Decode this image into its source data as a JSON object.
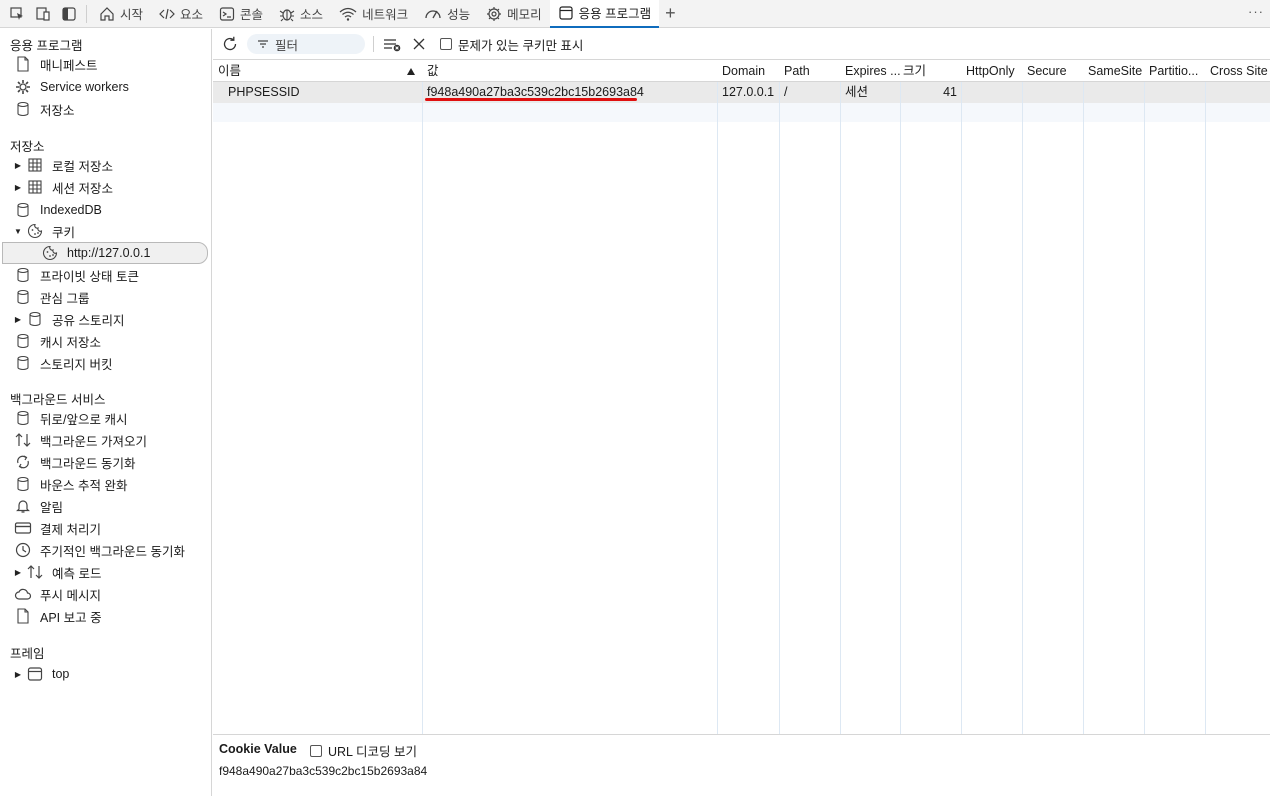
{
  "topbar": {
    "tabs": [
      {
        "label": "시작",
        "icon": "home-icon"
      },
      {
        "label": "요소",
        "icon": "code-icon"
      },
      {
        "label": "콘솔",
        "icon": "console-icon"
      },
      {
        "label": "소스",
        "icon": "bug-icon"
      },
      {
        "label": "네트워크",
        "icon": "wifi-icon"
      },
      {
        "label": "성능",
        "icon": "gauge-icon"
      },
      {
        "label": "메모리",
        "icon": "chip-icon"
      },
      {
        "label": "응용 프로그램",
        "icon": "app-icon",
        "active": true
      }
    ],
    "add_tab": "+",
    "more": "···"
  },
  "sidebar": {
    "sections": [
      {
        "title": "응용 프로그램",
        "items": [
          {
            "label": "매니페스트",
            "icon": "document-icon"
          },
          {
            "label": "Service workers",
            "icon": "gear-icon"
          },
          {
            "label": "저장소",
            "icon": "database-icon"
          }
        ]
      },
      {
        "title": "저장소",
        "items": [
          {
            "label": "로컬 저장소",
            "icon": "grid-icon",
            "expandable": true,
            "expanded": false
          },
          {
            "label": "세션 저장소",
            "icon": "grid-icon",
            "expandable": true,
            "expanded": false
          },
          {
            "label": "IndexedDB",
            "icon": "database-icon"
          },
          {
            "label": "쿠키",
            "icon": "cookie-icon",
            "expandable": true,
            "expanded": true
          },
          {
            "label": "http://127.0.0.1",
            "icon": "cookie-icon",
            "selected": true,
            "child": true
          },
          {
            "label": "프라이빗 상태 토큰",
            "icon": "database-icon"
          },
          {
            "label": "관심 그룹",
            "icon": "database-icon"
          },
          {
            "label": "공유 스토리지",
            "icon": "database-icon",
            "expandable": true,
            "expanded": false
          },
          {
            "label": "캐시 저장소",
            "icon": "database-icon"
          },
          {
            "label": "스토리지 버킷",
            "icon": "database-icon"
          }
        ]
      },
      {
        "title": "백그라운드 서비스",
        "items": [
          {
            "label": "뒤로/앞으로 캐시",
            "icon": "database-icon"
          },
          {
            "label": "백그라운드 가져오기",
            "icon": "updown-icon"
          },
          {
            "label": "백그라운드 동기화",
            "icon": "sync-icon"
          },
          {
            "label": "바운스 추적 완화",
            "icon": "database-icon"
          },
          {
            "label": "알림",
            "icon": "bell-icon"
          },
          {
            "label": "결제 처리기",
            "icon": "card-icon"
          },
          {
            "label": "주기적인 백그라운드 동기화",
            "icon": "clock-icon"
          },
          {
            "label": "예측 로드",
            "icon": "updown-icon",
            "expandable": true,
            "expanded": false
          },
          {
            "label": "푸시 메시지",
            "icon": "cloud-icon"
          },
          {
            "label": "API 보고 중",
            "icon": "document-icon"
          }
        ]
      },
      {
        "title": "프레임",
        "items": [
          {
            "label": "top",
            "icon": "frame-icon",
            "expandable": true,
            "expanded": false
          }
        ]
      }
    ]
  },
  "toolbar": {
    "filter_placeholder": "필터",
    "only_issues_label": "문제가 있는 쿠키만 표시"
  },
  "table": {
    "columns": [
      "이름",
      "값",
      "Domain",
      "Path",
      "Expires ...",
      "크기",
      "HttpOnly",
      "Secure",
      "SameSite",
      "Partitio...",
      "Cross Site"
    ],
    "rows": [
      {
        "name": "PHPSESSID",
        "value": "f948a490a27ba3c539c2bc15b2693a84",
        "domain": "127.0.0.1",
        "path": "/",
        "expires": "세션",
        "size": "41",
        "httponly": "",
        "secure": "",
        "samesite": "",
        "partition": "",
        "crosssite": ""
      }
    ]
  },
  "cookie_panel": {
    "title": "Cookie Value",
    "url_decode_label": "URL 디코딩 보기",
    "value": "f948a490a27ba3c539c2bc15b2693a84"
  },
  "colors": {
    "accent": "#0f6cbd",
    "highlight": "#e01010",
    "selected_row": "#eaeaea"
  }
}
